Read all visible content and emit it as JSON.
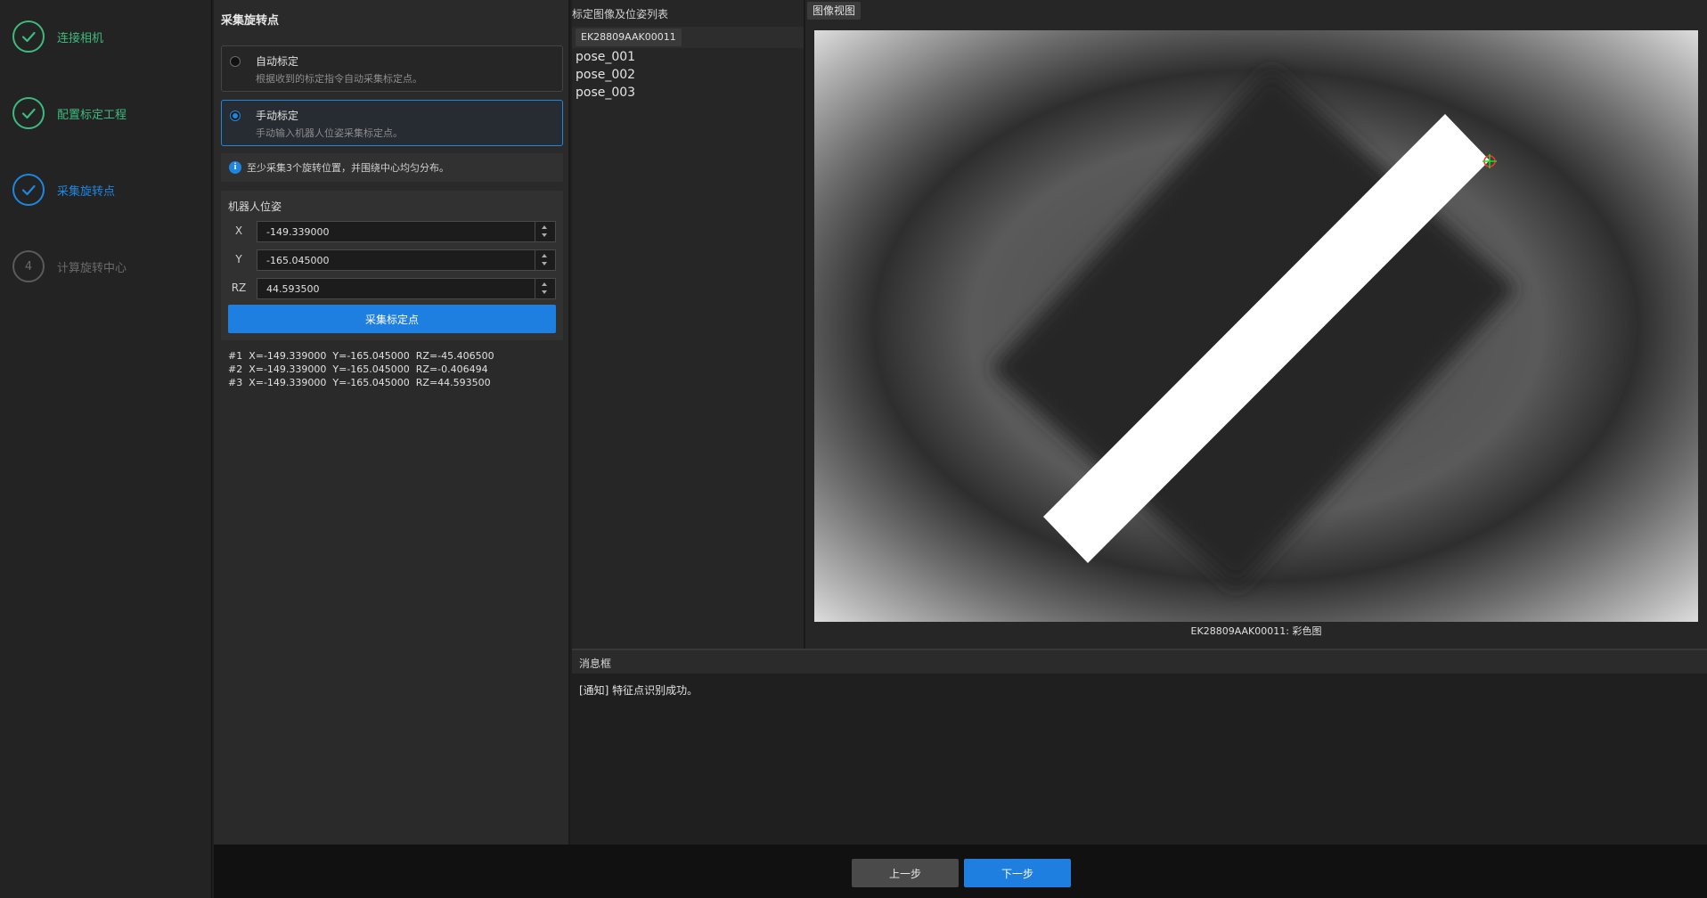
{
  "stepper": {
    "steps": [
      {
        "label": "连接相机",
        "state": "done"
      },
      {
        "label": "配置标定工程",
        "state": "done"
      },
      {
        "label": "采集旋转点",
        "state": "active"
      },
      {
        "number": "4",
        "label": "计算旋转中心",
        "state": "pending"
      }
    ]
  },
  "config": {
    "title": "采集旋转点",
    "auto": {
      "title": "自动标定",
      "desc": "根据收到的标定指令自动采集标定点。",
      "selected": false
    },
    "manual": {
      "title": "手动标定",
      "desc": "手动输入机器人位姿采集标定点。",
      "selected": true
    },
    "hint": "至少采集3个旋转位置，并围绕中心均匀分布。",
    "pose": {
      "title": "机器人位姿",
      "fields": [
        {
          "label": "X",
          "value": "-149.339000"
        },
        {
          "label": "Y",
          "value": "-165.045000"
        },
        {
          "label": "RZ",
          "value": "44.593500"
        }
      ],
      "capture_button": "采集标定点"
    },
    "records": [
      "#1  X=-149.339000  Y=-165.045000  RZ=-45.406500",
      "#2  X=-149.339000  Y=-165.045000  RZ=-0.406494",
      "#3  X=-149.339000  Y=-165.045000  RZ=44.593500"
    ]
  },
  "image_list": {
    "title": "标定图像及位姿列表",
    "camera": "EK28809AAK00011",
    "poses": [
      "pose_001",
      "pose_002",
      "pose_003"
    ]
  },
  "image_view": {
    "tab": "图像视图",
    "caption": "EK28809AAK00011: 彩色图"
  },
  "messages": {
    "title": "消息框",
    "lines": [
      "[通知] 特征点识别成功。"
    ]
  },
  "footer": {
    "prev": "上一步",
    "next": "下一步"
  },
  "colors": {
    "accent": "#1f7fe0",
    "done": "#3dba7e",
    "pending": "#5a5a5a"
  }
}
